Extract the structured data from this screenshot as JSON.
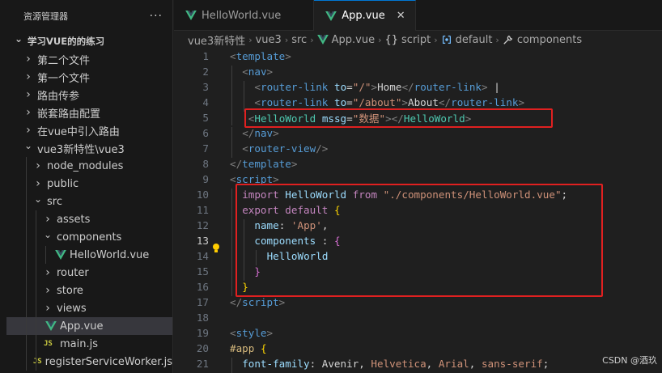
{
  "explorer": {
    "title": "资源管理器",
    "more_label": "···",
    "items": [
      {
        "label": "学习VUE的的练习",
        "depth": 0,
        "type": "folder-open",
        "bold": true
      },
      {
        "label": "第二个文件",
        "depth": 1,
        "type": "folder"
      },
      {
        "label": "第一个文件",
        "depth": 1,
        "type": "folder"
      },
      {
        "label": "路由传参",
        "depth": 1,
        "type": "folder"
      },
      {
        "label": "嵌套路由配置",
        "depth": 1,
        "type": "folder"
      },
      {
        "label": "在vue中引入路由",
        "depth": 1,
        "type": "folder"
      },
      {
        "label": "vue3新特性\\vue3",
        "depth": 1,
        "type": "folder-open"
      },
      {
        "label": "node_modules",
        "depth": 2,
        "type": "folder"
      },
      {
        "label": "public",
        "depth": 2,
        "type": "folder"
      },
      {
        "label": "src",
        "depth": 2,
        "type": "folder-open"
      },
      {
        "label": "assets",
        "depth": 3,
        "type": "folder"
      },
      {
        "label": "components",
        "depth": 3,
        "type": "folder-open"
      },
      {
        "label": "HelloWorld.vue",
        "depth": 4,
        "type": "vue"
      },
      {
        "label": "router",
        "depth": 3,
        "type": "folder"
      },
      {
        "label": "store",
        "depth": 3,
        "type": "folder"
      },
      {
        "label": "views",
        "depth": 3,
        "type": "folder"
      },
      {
        "label": "App.vue",
        "depth": 3,
        "type": "vue",
        "selected": true
      },
      {
        "label": "main.js",
        "depth": 3,
        "type": "js",
        "icon_text": "JS"
      },
      {
        "label": "registerServiceWorker.js",
        "depth": 3,
        "type": "js",
        "icon_text": "JS"
      }
    ]
  },
  "tabs": [
    {
      "label": "HelloWorld.vue",
      "active": false
    },
    {
      "label": "App.vue",
      "active": true,
      "close": "✕"
    }
  ],
  "breadcrumb": [
    {
      "label": "vue3新特性"
    },
    {
      "label": "vue3"
    },
    {
      "label": "src"
    },
    {
      "label": "App.vue",
      "icon": "vue-icon"
    },
    {
      "label": "script",
      "icon": "braces-icon",
      "prefix": "{}"
    },
    {
      "label": "default",
      "icon": "module-icon"
    },
    {
      "label": "components",
      "icon": "wrench-icon"
    }
  ],
  "editor": {
    "current_line": 13,
    "lines": [
      {
        "n": 1,
        "indent": 0,
        "tokens": [
          [
            "punc",
            "<"
          ],
          [
            "tag",
            "template"
          ],
          [
            "punc",
            ">"
          ]
        ]
      },
      {
        "n": 2,
        "indent": 1,
        "tokens": [
          [
            "punc",
            "<"
          ],
          [
            "tag",
            "nav"
          ],
          [
            "punc",
            ">"
          ]
        ]
      },
      {
        "n": 3,
        "indent": 2,
        "tokens": [
          [
            "punc",
            "<"
          ],
          [
            "tag",
            "router-link"
          ],
          [
            "text",
            " "
          ],
          [
            "attr",
            "to"
          ],
          [
            "text",
            "="
          ],
          [
            "str",
            "\"/\""
          ],
          [
            "punc",
            ">"
          ],
          [
            "text",
            "Home"
          ],
          [
            "punc",
            "</"
          ],
          [
            "tag",
            "router-link"
          ],
          [
            "punc",
            ">"
          ],
          [
            "text",
            " |"
          ]
        ]
      },
      {
        "n": 4,
        "indent": 2,
        "tokens": [
          [
            "punc",
            "<"
          ],
          [
            "tag",
            "router-link"
          ],
          [
            "text",
            " "
          ],
          [
            "attr",
            "to"
          ],
          [
            "text",
            "="
          ],
          [
            "str",
            "\"/about\""
          ],
          [
            "punc",
            ">"
          ],
          [
            "text",
            "About"
          ],
          [
            "punc",
            "</"
          ],
          [
            "tag",
            "router-link"
          ],
          [
            "punc",
            ">"
          ]
        ]
      },
      {
        "n": 5,
        "indent": 1.5,
        "tokens": [
          [
            "punc",
            "<"
          ],
          [
            "comp",
            "HelloWorld"
          ],
          [
            "text",
            " "
          ],
          [
            "attr",
            "mssg"
          ],
          [
            "text",
            "="
          ],
          [
            "str",
            "\"数据\""
          ],
          [
            "punc",
            "></"
          ],
          [
            "comp",
            "HelloWorld"
          ],
          [
            "punc",
            ">"
          ]
        ]
      },
      {
        "n": 6,
        "indent": 1,
        "tokens": [
          [
            "punc",
            "</"
          ],
          [
            "tag",
            "nav"
          ],
          [
            "punc",
            ">"
          ]
        ]
      },
      {
        "n": 7,
        "indent": 1,
        "tokens": [
          [
            "punc",
            "<"
          ],
          [
            "tag",
            "router-view"
          ],
          [
            "punc",
            "/>"
          ]
        ]
      },
      {
        "n": 8,
        "indent": 0,
        "tokens": [
          [
            "punc",
            "</"
          ],
          [
            "tag",
            "template"
          ],
          [
            "punc",
            ">"
          ]
        ]
      },
      {
        "n": 9,
        "indent": 0,
        "tokens": [
          [
            "punc",
            "<"
          ],
          [
            "tag",
            "script"
          ],
          [
            "punc",
            ">"
          ]
        ]
      },
      {
        "n": 10,
        "indent": 1,
        "tokens": [
          [
            "kw",
            "import"
          ],
          [
            "text",
            " "
          ],
          [
            "prop",
            "HelloWorld"
          ],
          [
            "text",
            " "
          ],
          [
            "kw",
            "from"
          ],
          [
            "text",
            " "
          ],
          [
            "str",
            "\"./components/HelloWorld.vue\""
          ],
          [
            "text",
            ";"
          ]
        ]
      },
      {
        "n": 11,
        "indent": 1,
        "tokens": [
          [
            "kw",
            "export"
          ],
          [
            "text",
            " "
          ],
          [
            "kw",
            "default"
          ],
          [
            "text",
            " "
          ],
          [
            "brace1",
            "{"
          ]
        ]
      },
      {
        "n": 12,
        "indent": 2,
        "tokens": [
          [
            "prop",
            "name"
          ],
          [
            "text",
            ": "
          ],
          [
            "str",
            "'App'"
          ],
          [
            "text",
            ","
          ]
        ]
      },
      {
        "n": 13,
        "indent": 2,
        "tokens": [
          [
            "prop",
            "components"
          ],
          [
            "text",
            " : "
          ],
          [
            "brace2",
            "{"
          ]
        ],
        "bulb": true
      },
      {
        "n": 14,
        "indent": 3,
        "tokens": [
          [
            "prop",
            "HelloWorld"
          ]
        ]
      },
      {
        "n": 15,
        "indent": 2,
        "tokens": [
          [
            "brace2",
            "}"
          ]
        ]
      },
      {
        "n": 16,
        "indent": 1,
        "tokens": [
          [
            "brace1",
            "}"
          ]
        ]
      },
      {
        "n": 17,
        "indent": 0,
        "tokens": [
          [
            "punc",
            "</"
          ],
          [
            "tag",
            "script"
          ],
          [
            "punc",
            ">"
          ]
        ]
      },
      {
        "n": 18,
        "indent": 0,
        "tokens": []
      },
      {
        "n": 19,
        "indent": 0,
        "tokens": [
          [
            "punc",
            "<"
          ],
          [
            "tag",
            "style"
          ],
          [
            "punc",
            ">"
          ]
        ]
      },
      {
        "n": 20,
        "indent": 0,
        "tokens": [
          [
            "sel",
            "#app"
          ],
          [
            "text",
            " "
          ],
          [
            "brace1",
            "{"
          ]
        ]
      },
      {
        "n": 21,
        "indent": 1,
        "tokens": [
          [
            "prop",
            "font-family"
          ],
          [
            "text",
            ": Avenir, "
          ],
          [
            "str2",
            "Helvetica"
          ],
          [
            "text",
            ", "
          ],
          [
            "str2",
            "Arial"
          ],
          [
            "text",
            ", "
          ],
          [
            "str2",
            "sans-serif"
          ],
          [
            "text",
            ";"
          ]
        ]
      }
    ]
  },
  "watermark": "CSDN @酒玖",
  "colors": {
    "accent": "#0078d4",
    "highlight_box": "#e02020",
    "vue_green": "#41b883"
  }
}
